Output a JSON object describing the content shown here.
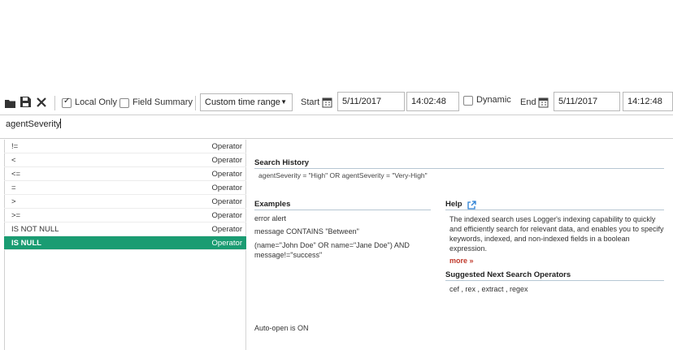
{
  "toolbar": {
    "icons": [
      "folder-icon",
      "save-icon",
      "close-icon"
    ],
    "local_only": {
      "label": "Local Only",
      "checked": true
    },
    "field_summary": {
      "label": "Field Summary",
      "checked": false
    },
    "time_range": "Custom time range",
    "start_label": "Start",
    "start_date": "5/11/2017",
    "start_time": "14:02:48",
    "dynamic": {
      "label": "Dynamic",
      "checked": false
    },
    "end_label": "End",
    "end_date": "5/11/2017",
    "end_time": "14:12:48"
  },
  "search": {
    "query": "agentSeverity"
  },
  "operators": [
    {
      "symbol": "!=",
      "type": "Operator"
    },
    {
      "symbol": "<",
      "type": "Operator"
    },
    {
      "symbol": "<=",
      "type": "Operator"
    },
    {
      "symbol": "=",
      "type": "Operator"
    },
    {
      "symbol": ">",
      "type": "Operator"
    },
    {
      "symbol": ">=",
      "type": "Operator"
    },
    {
      "symbol": "IS NOT NULL",
      "type": "Operator"
    },
    {
      "symbol": "IS NULL",
      "type": "Operator",
      "selected": true
    }
  ],
  "history": {
    "title": "Search History",
    "entry": "agentSeverity = \"High\" OR agentSeverity = \"Very-High\""
  },
  "examples": {
    "title": "Examples",
    "items": [
      "error alert",
      "message CONTAINS \"Between\"",
      "(name=\"John Doe\" OR name=\"Jane Doe\") AND message!=\"success\""
    ]
  },
  "help": {
    "title": "Help",
    "text": "The indexed search uses Logger's indexing capability to quickly and efficiently search for relevant data, and enables you to specify keywords, indexed, and non-indexed fields in a boolean expression.",
    "more": "more »"
  },
  "suggested": {
    "title": "Suggested Next Search Operators",
    "items": "cef , rex , extract , regex"
  },
  "autoopen": "Auto-open is ON",
  "colors": {
    "selected": "#1a9c72",
    "more": "#c0392b",
    "link": "#2a7fd4"
  }
}
